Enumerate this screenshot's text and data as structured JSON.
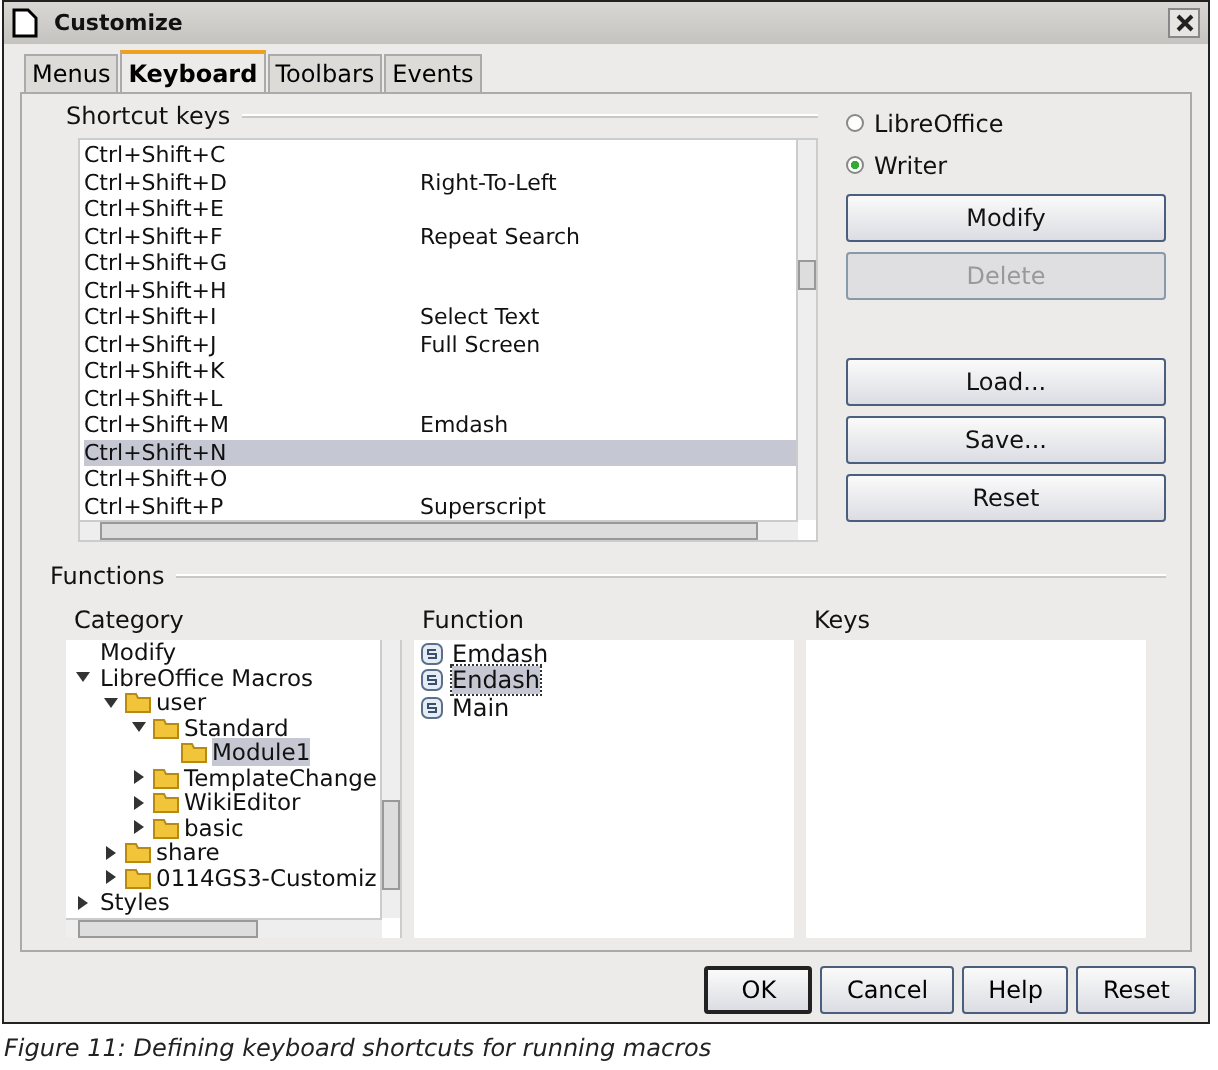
{
  "window": {
    "title": "Customize"
  },
  "tabs": [
    {
      "label": "Menus",
      "selected": false
    },
    {
      "label": "Keyboard",
      "selected": true
    },
    {
      "label": "Toolbars",
      "selected": false
    },
    {
      "label": "Events",
      "selected": false
    }
  ],
  "shortcut_keys": {
    "title": "Shortcut keys",
    "rows": [
      {
        "key": "Ctrl+Shift+C",
        "function": "",
        "selected": false
      },
      {
        "key": "Ctrl+Shift+D",
        "function": "Right-To-Left",
        "selected": false
      },
      {
        "key": "Ctrl+Shift+E",
        "function": "",
        "selected": false
      },
      {
        "key": "Ctrl+Shift+F",
        "function": "Repeat Search",
        "selected": false
      },
      {
        "key": "Ctrl+Shift+G",
        "function": "",
        "selected": false
      },
      {
        "key": "Ctrl+Shift+H",
        "function": "",
        "selected": false
      },
      {
        "key": "Ctrl+Shift+I",
        "function": "Select Text",
        "selected": false
      },
      {
        "key": "Ctrl+Shift+J",
        "function": "Full Screen",
        "selected": false
      },
      {
        "key": "Ctrl+Shift+K",
        "function": "",
        "selected": false
      },
      {
        "key": "Ctrl+Shift+L",
        "function": "",
        "selected": false
      },
      {
        "key": "Ctrl+Shift+M",
        "function": "Emdash",
        "selected": false
      },
      {
        "key": "Ctrl+Shift+N",
        "function": "",
        "selected": true
      },
      {
        "key": "Ctrl+Shift+O",
        "function": "",
        "selected": false
      },
      {
        "key": "Ctrl+Shift+P",
        "function": "Superscript",
        "selected": false
      }
    ]
  },
  "scope": [
    {
      "label": "LibreOffice",
      "selected": false
    },
    {
      "label": "Writer",
      "selected": true
    }
  ],
  "side_buttons": [
    {
      "label": "Modify",
      "disabled": false
    },
    {
      "label": "Delete",
      "disabled": true
    },
    {
      "label": "Load...",
      "disabled": false
    },
    {
      "label": "Save...",
      "disabled": false
    },
    {
      "label": "Reset",
      "disabled": false
    }
  ],
  "functions": {
    "title": "Functions",
    "category": {
      "title": "Category",
      "items": [
        {
          "label": "Modify",
          "kind": "plain"
        },
        {
          "label": "LibreOffice Macros",
          "kind": "plain",
          "expanded": true,
          "children": [
            {
              "label": "user",
              "kind": "folder",
              "expanded": true,
              "children": [
                {
                  "label": "Standard",
                  "kind": "folder",
                  "expanded": true,
                  "children": [
                    {
                      "label": "Module1",
                      "kind": "folder",
                      "selected": true
                    }
                  ]
                },
                {
                  "label": "TemplateChange",
                  "kind": "folder",
                  "expanded": false
                },
                {
                  "label": "WikiEditor",
                  "kind": "folder",
                  "expanded": false
                },
                {
                  "label": "basic",
                  "kind": "folder",
                  "expanded": false
                }
              ]
            },
            {
              "label": "share",
              "kind": "folder",
              "expanded": false
            },
            {
              "label": "0114GS3-Customiz",
              "kind": "folder",
              "expanded": false
            }
          ]
        },
        {
          "label": "Styles",
          "kind": "plain",
          "expanded": false
        }
      ]
    },
    "function": {
      "title": "Function",
      "items": [
        {
          "label": "Emdash",
          "selected": false
        },
        {
          "label": "Endash",
          "selected": true
        },
        {
          "label": "Main",
          "selected": false
        }
      ]
    },
    "keys": {
      "title": "Keys"
    }
  },
  "dialog_buttons": [
    {
      "label": "OK",
      "default": true
    },
    {
      "label": "Cancel",
      "default": false
    },
    {
      "label": "Help",
      "default": false
    },
    {
      "label": "Reset",
      "default": false
    }
  ],
  "caption": "Figure 11: Defining keyboard shortcuts for running macros"
}
